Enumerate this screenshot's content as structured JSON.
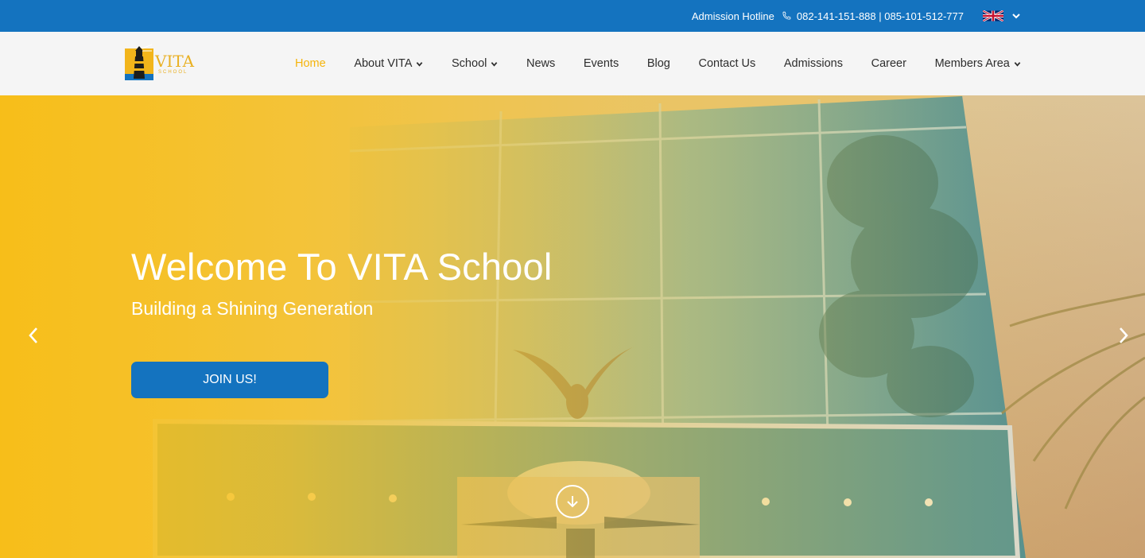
{
  "topbar": {
    "hotline_label": "Admission Hotline",
    "hotline_numbers": "082-141-151-888 | 085-101-512-777",
    "language": "English",
    "colors": {
      "background": "#1473bf",
      "text": "#ffffff"
    }
  },
  "brand": {
    "name": "VITA",
    "tagline": "SCHOOL",
    "colors": {
      "primary": "#e9b022"
    }
  },
  "nav": {
    "items": [
      {
        "label": "Home",
        "active": true,
        "has_dropdown": false
      },
      {
        "label": "About VITA",
        "active": false,
        "has_dropdown": true
      },
      {
        "label": "School",
        "active": false,
        "has_dropdown": true
      },
      {
        "label": "News",
        "active": false,
        "has_dropdown": false
      },
      {
        "label": "Events",
        "active": false,
        "has_dropdown": false
      },
      {
        "label": "Blog",
        "active": false,
        "has_dropdown": false
      },
      {
        "label": "Contact Us",
        "active": false,
        "has_dropdown": false
      },
      {
        "label": "Admissions",
        "active": false,
        "has_dropdown": false
      },
      {
        "label": "Career",
        "active": false,
        "has_dropdown": false
      },
      {
        "label": "Members Area",
        "active": false,
        "has_dropdown": true
      }
    ],
    "active_color": "#f5b40b"
  },
  "hero": {
    "title": "Welcome To VITA School",
    "subtitle": "Building a Shining Generation",
    "cta_label": "JOIN US!",
    "cta_color": "#1473bf",
    "overlay_color": "#f8be14",
    "icons": {
      "prev": "chevron-left-icon",
      "next": "chevron-right-icon",
      "scroll": "arrow-down-circle-icon"
    }
  }
}
